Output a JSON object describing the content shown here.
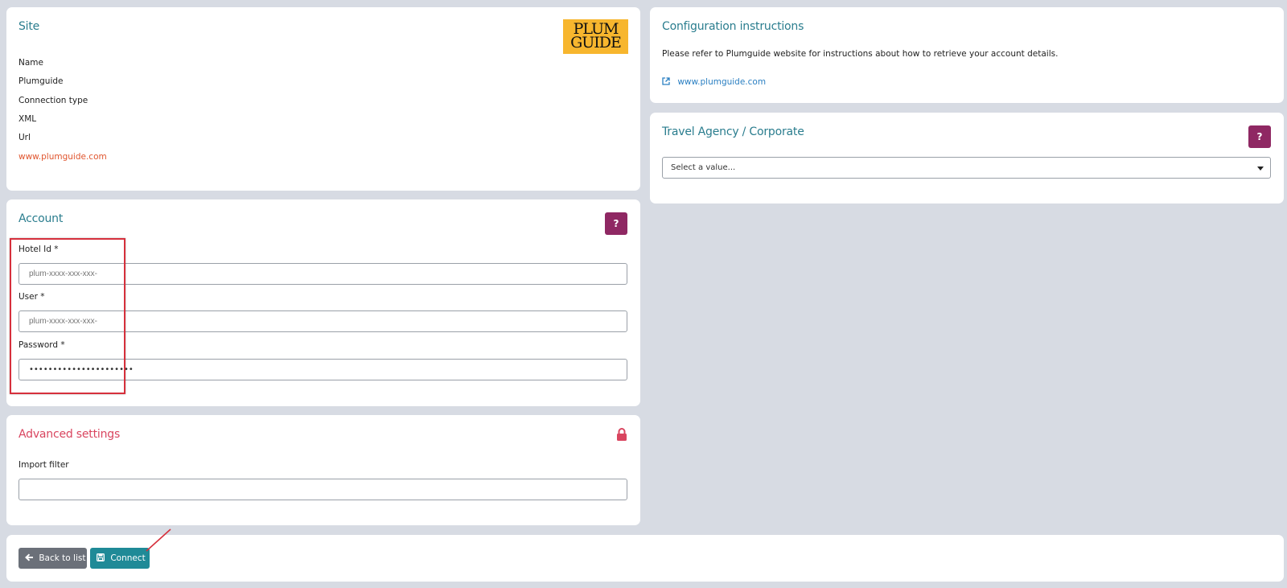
{
  "site": {
    "title": "Site",
    "logo_line1": "PLUM",
    "logo_line2": "GUIDE",
    "name_label": "Name",
    "name_value": "Plumguide",
    "conn_label": "Connection type",
    "conn_value": "XML",
    "url_label": "Url",
    "url_value": "www.plumguide.com"
  },
  "account": {
    "title": "Account",
    "help": "?",
    "hotel_label": "Hotel Id  *",
    "hotel_placeholder": "plum-xxxx-xxx-xxx-",
    "user_label": "User  *",
    "user_placeholder": "plum-xxxx-xxx-xxx-",
    "password_label": "Password  *",
    "password_value": "••••••••••••••••••••••"
  },
  "advanced": {
    "title": "Advanced settings",
    "import_label": "Import filter",
    "import_value": ""
  },
  "config": {
    "title": "Configuration instructions",
    "text": "Please refer to Plumguide website for instructions about how to retrieve your account details.",
    "link": "www.plumguide.com"
  },
  "agency": {
    "title": "Travel Agency / Corporate",
    "help": "?",
    "select_value": "Select a value..."
  },
  "footer": {
    "back_label": "Back to list",
    "connect_label": "Connect"
  },
  "icons": {
    "back": "arrow-left-icon",
    "connect": "save-icon",
    "lock": "lock-icon",
    "link": "external-link-icon"
  },
  "colors": {
    "accent": "#2a7d8e",
    "help_button": "#8f2863",
    "connect_button": "#1f8a97",
    "back_button": "#6b7079",
    "advanced_title": "#d9455f",
    "url_value": "#e0552e",
    "highlight": "#d6303c"
  }
}
